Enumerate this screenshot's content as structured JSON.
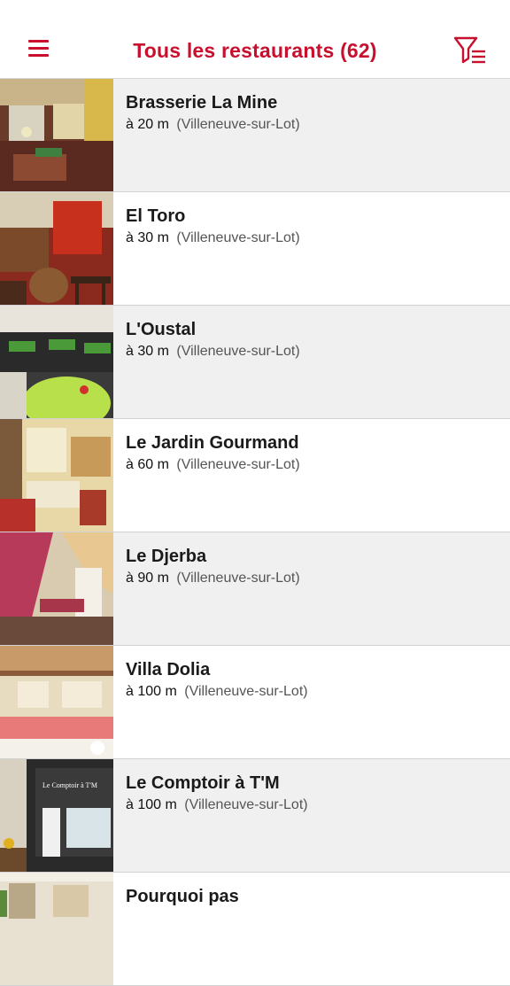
{
  "header": {
    "title": "Tous les restaurants (62)",
    "menu_icon": "hamburger-menu-icon",
    "filter_icon": "filter-list-icon",
    "accent_color": "#c8102e"
  },
  "restaurants": [
    {
      "name": "Brasserie La Mine",
      "distance": "à 20 m",
      "city": "(Villeneuve-sur-Lot)"
    },
    {
      "name": "El Toro",
      "distance": "à 30 m",
      "city": "(Villeneuve-sur-Lot)"
    },
    {
      "name": "L'Oustal",
      "distance": "à 30 m",
      "city": "(Villeneuve-sur-Lot)"
    },
    {
      "name": "Le Jardin Gourmand",
      "distance": "à 60 m",
      "city": "(Villeneuve-sur-Lot)"
    },
    {
      "name": "Le Djerba",
      "distance": "à 90 m",
      "city": "(Villeneuve-sur-Lot)"
    },
    {
      "name": "Villa Dolia",
      "distance": "à 100 m",
      "city": "(Villeneuve-sur-Lot)"
    },
    {
      "name": "Le Comptoir à T'M",
      "distance": "à 100 m",
      "city": "(Villeneuve-sur-Lot)"
    },
    {
      "name": "Pourquoi pas",
      "distance": "",
      "city": ""
    }
  ],
  "thumbnail_signs": {
    "comptoir_sign": "Le Comptoir à T'M"
  }
}
